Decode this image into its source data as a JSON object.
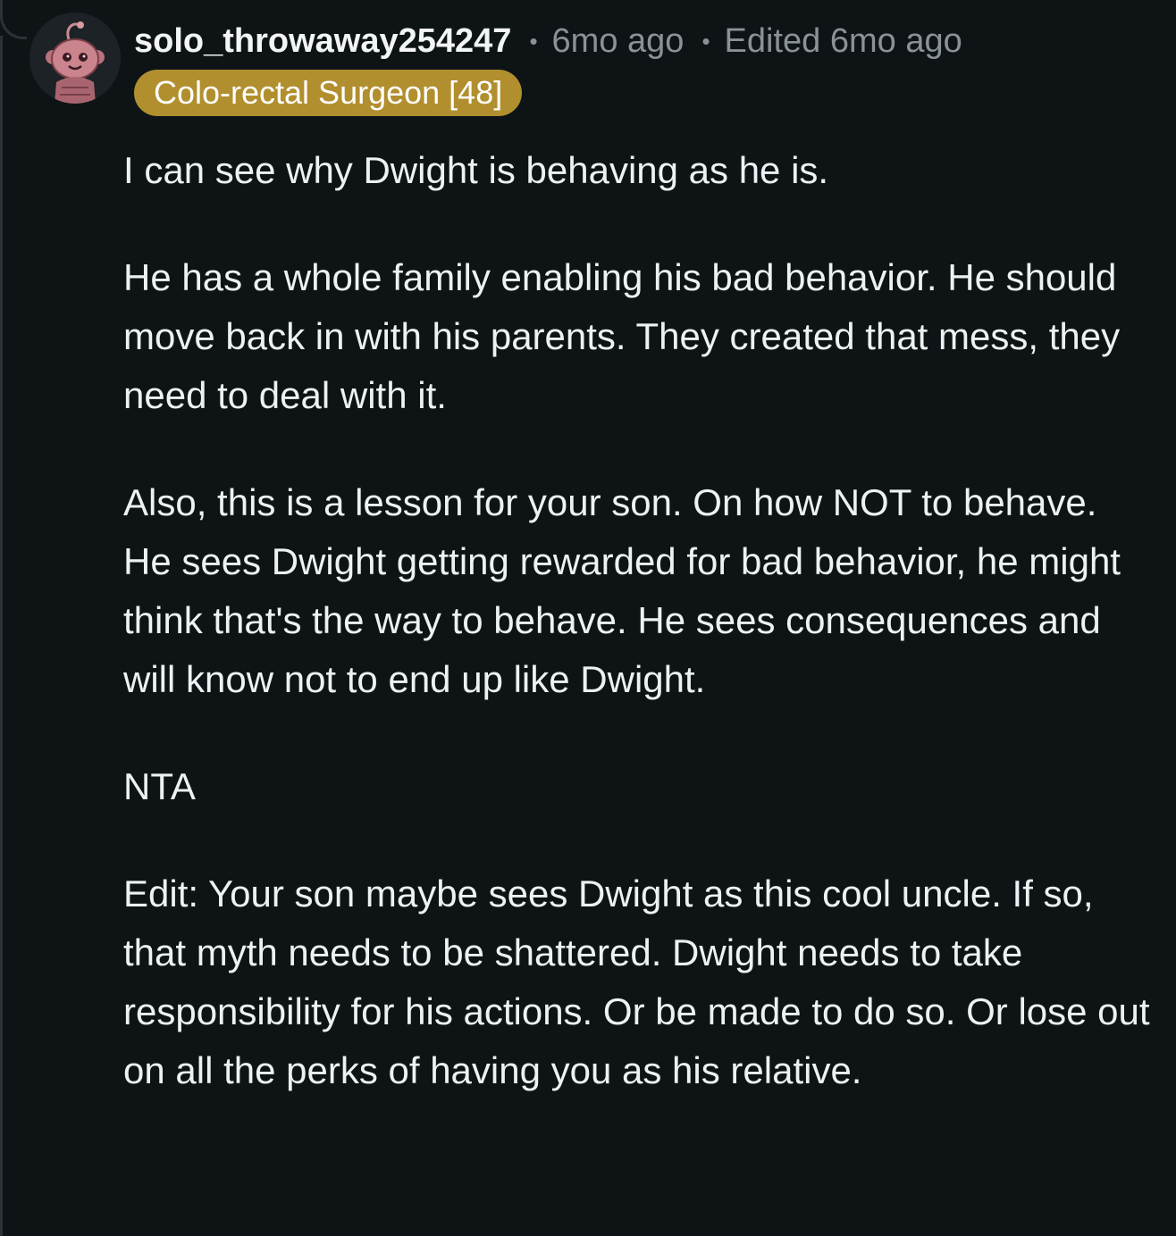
{
  "comment": {
    "username": "solo_throwaway254247",
    "separator_1": "•",
    "posted_ago": "6mo ago",
    "separator_2": "•",
    "edited": "Edited 6mo ago",
    "flair": "Colo-rectal Surgeon [48]",
    "paragraphs": [
      "I can see why Dwight is behaving as he is.",
      "He has a whole family enabling his bad behavior. He should move back in with his parents. They created that mess, they need to deal with it.",
      "Also, this is a lesson for your son. On how NOT to behave. He sees Dwight getting rewarded for bad behavior, he might think that's the way to behave. He sees consequences and will know not to end up like Dwight.",
      "NTA",
      "Edit: Your son maybe sees Dwight as this cool uncle. If so, that myth needs to be shattered. Dwight needs to take responsibility for his actions. Or be made to do so. Or lose out on all the perks of having you as his relative."
    ]
  },
  "colors": {
    "background": "#0e1416",
    "text": "#eef1f3",
    "muted": "#8b9296",
    "flair_bg": "#b18f2e",
    "thread_line": "#2b3236"
  },
  "icons": {
    "avatar": "pink-snoo-avatar-icon"
  }
}
